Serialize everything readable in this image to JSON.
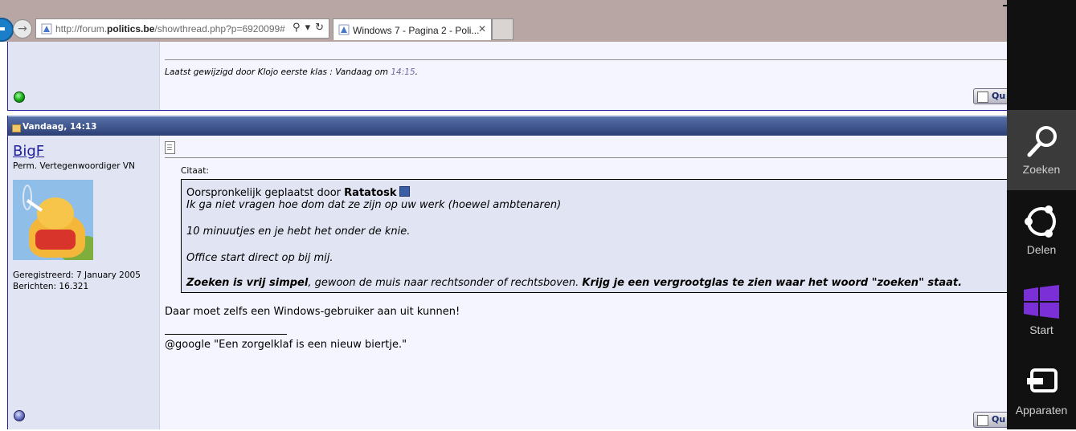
{
  "browser": {
    "url_prefix": "http://forum.",
    "url_domain": "politics.be",
    "url_suffix": "/showthread.php?p=6920099#",
    "url_tools": [
      "⚲",
      "▾",
      "↻"
    ],
    "tab_title": "Windows 7 - Pagina 2 - Poli...",
    "tab_close": "✕",
    "forward_glyph": "→"
  },
  "post1": {
    "edited_text": "Laatst gewijzigd door Klojo eerste klas : Vandaag om",
    "edited_time": "14:15",
    "edited_end": ".",
    "quote_label": "Qu"
  },
  "post2": {
    "date": "Vandaag, 14:13",
    "username": "BigF",
    "user_title": "Perm. Vertegenwoordiger VN",
    "registered": "Geregistreerd: 7 January 2005",
    "posts": "Berichten: 16.321",
    "citaat_label": "Citaat:",
    "quote_origin_prefix": "Oorspronkelijk geplaatst door",
    "quote_author": "Ratatosk",
    "quote_lines": [
      "Ik ga niet vragen hoe dom dat ze zijn op uw werk (hoewel ambtenaren)",
      "10 minuutjes en je hebt het onder de knie.",
      "Office start direct op bij mij."
    ],
    "quote_last_bold1": "Zoeken is vrij simpel",
    "quote_last_mid": ", gewoon de muis naar rechtsonder of rechtsboven. ",
    "quote_last_bold2": "Krijg je een vergrootglas te zien waar het woord \"zoeken\" staat.",
    "body_text": "Daar moet zelfs een Windows-gebruiker aan uit kunnen!",
    "signature": "@google \"Een zorgelklaf is een nieuw biertje.\"",
    "quote_label": "Qu"
  },
  "charms": {
    "items": [
      {
        "label": "Zoeken",
        "icon": "search-icon"
      },
      {
        "label": "Delen",
        "icon": "share-icon"
      },
      {
        "label": "Start",
        "icon": "windows-logo-icon"
      },
      {
        "label": "Apparaten",
        "icon": "devices-icon"
      }
    ],
    "active_color": "#3a3a3a",
    "start_logo_color": "#7b2fd6"
  }
}
